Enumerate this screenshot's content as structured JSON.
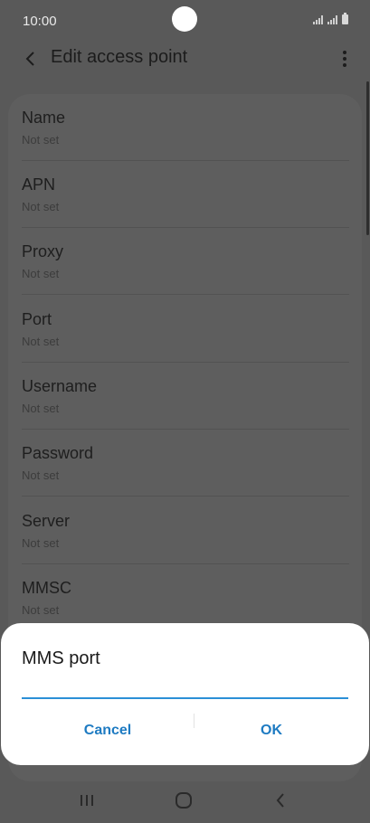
{
  "status_bar": {
    "time": "10:00"
  },
  "app_bar": {
    "title": "Edit access point"
  },
  "settings": [
    {
      "label": "Name",
      "value": "Not set"
    },
    {
      "label": "APN",
      "value": "Not set"
    },
    {
      "label": "Proxy",
      "value": "Not set"
    },
    {
      "label": "Port",
      "value": "Not set"
    },
    {
      "label": "Username",
      "value": "Not set"
    },
    {
      "label": "Password",
      "value": "Not set"
    },
    {
      "label": "Server",
      "value": "Not set"
    },
    {
      "label": "MMSC",
      "value": "Not set"
    }
  ],
  "dialog": {
    "title": "MMS port",
    "input_value": "",
    "cancel_label": "Cancel",
    "ok_label": "OK"
  },
  "nav_bar": {
    "icons": [
      "recent-apps-icon",
      "home-icon",
      "back-icon"
    ]
  },
  "colors": {
    "accent": "#1e7bc2",
    "input_underline": "#2b8fd6",
    "dim_background": "#595959"
  }
}
